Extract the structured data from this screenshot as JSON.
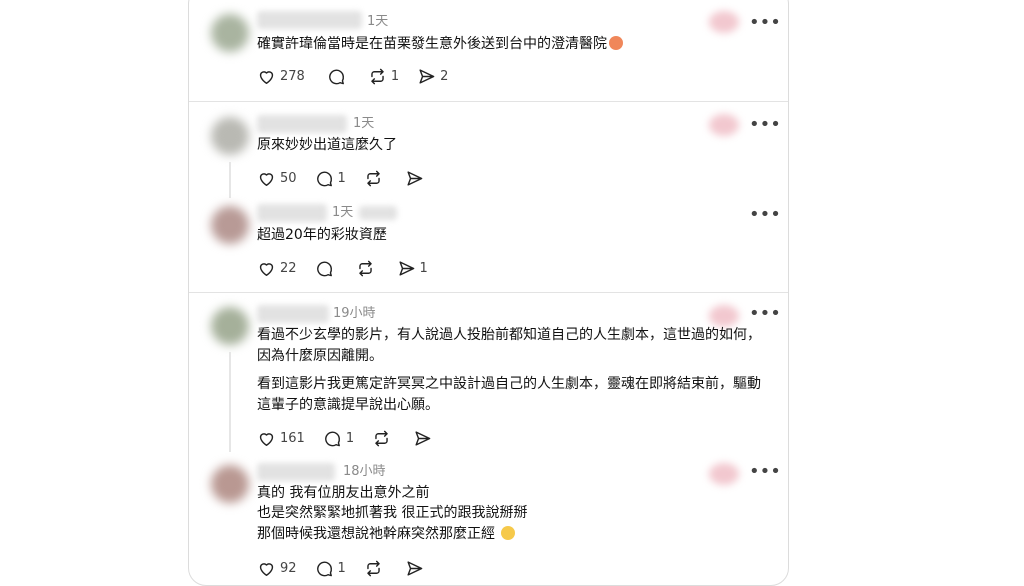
{
  "comments": [
    {
      "time": "1天",
      "text": "確實許瑋倫當時是在苗栗發生意外後送到台中的澄清醫院",
      "emoji": "😡",
      "likes": "278",
      "replies": "",
      "reposts": "1",
      "shares": "2"
    },
    {
      "time": "1天",
      "text": "原來妙妙出道這麼久了",
      "likes": "50",
      "replies": "1",
      "reposts": "",
      "shares": ""
    },
    {
      "time": "1天",
      "text": "超過20年的彩妝資歷",
      "likes": "22",
      "replies": "",
      "reposts": "",
      "shares": "1"
    },
    {
      "time": "19小時",
      "p1_line1": "看過不少玄學的影片，有人說過人投胎前都知道自己的人生劇本，這世過的如何，",
      "p1_line2": "因為什麼原因離開。",
      "p2_line1": "看到這影片我更篤定許冥冥之中設計過自己的人生劇本，靈魂在即將結束前，驅動",
      "p2_line2": "這輩子的意識提早說出心願。",
      "likes": "161",
      "replies": "1",
      "reposts": "",
      "shares": ""
    },
    {
      "time": "18小時",
      "line1": "真的 我有位朋友出意外之前",
      "line2": "也是突然緊緊地抓著我 很正式的跟我說掰掰",
      "line3": "那個時候我還想說祂幹麻突然那麼正經",
      "emoji": "🥺",
      "likes": "92",
      "replies": "1",
      "reposts": "",
      "shares": ""
    }
  ],
  "icons": {
    "like": "heart-icon",
    "reply": "speech-bubble-icon",
    "repost": "repost-icon",
    "share": "send-icon",
    "more": "more-options-icon"
  },
  "more_label": "•••"
}
